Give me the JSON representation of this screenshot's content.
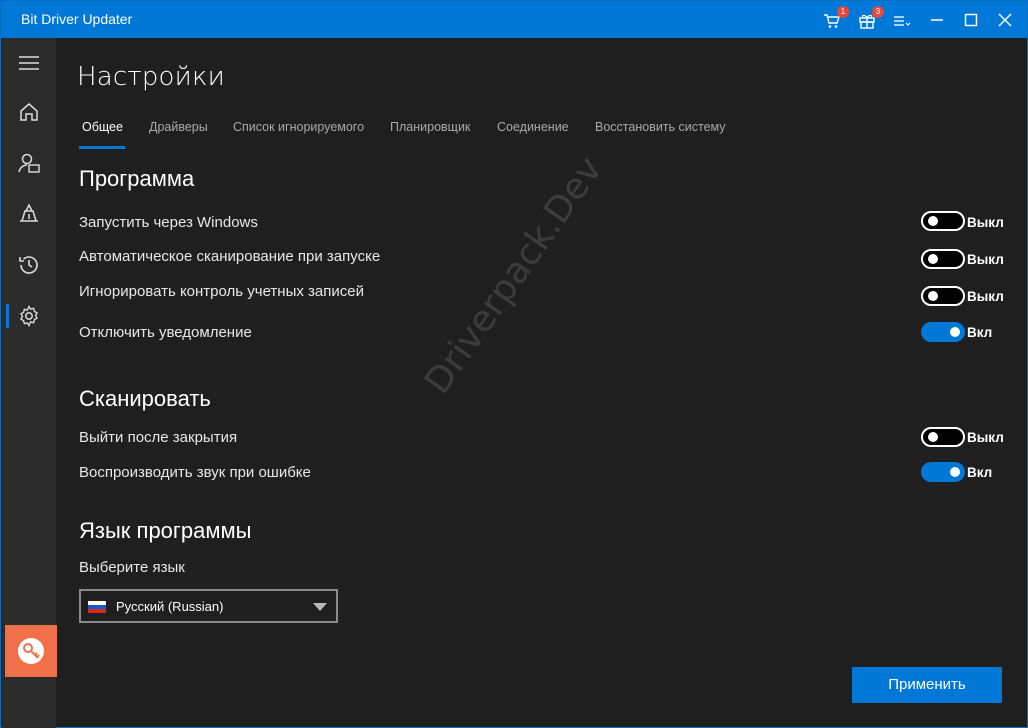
{
  "app": {
    "title": "Bit Driver Updater"
  },
  "titlebar": {
    "cart_badge": "1",
    "gift_badge": "3",
    "icons": [
      "cart-icon",
      "gift-icon",
      "menu-icon",
      "minimize-icon",
      "maximize-icon",
      "close-icon"
    ]
  },
  "sidebar": {
    "items": [
      "hamburger-icon",
      "home-icon",
      "user-scan-icon",
      "driver-icon",
      "history-icon",
      "settings-icon"
    ],
    "active": "settings-icon"
  },
  "page": {
    "title": "Настройки"
  },
  "tabs": [
    {
      "label": "Общее",
      "active": true
    },
    {
      "label": "Драйверы",
      "active": false
    },
    {
      "label": "Список игнорируемого",
      "active": false
    },
    {
      "label": "Планировщик",
      "active": false
    },
    {
      "label": "Соединение",
      "active": false
    },
    {
      "label": "Восстановить систему",
      "active": false
    }
  ],
  "sections": {
    "program": {
      "title": "Программа",
      "settings": [
        {
          "label": "Запустить через Windows",
          "state": "Выкл",
          "on": false
        },
        {
          "label": "Автоматическое сканирование при запуске",
          "state": "Выкл",
          "on": false
        },
        {
          "label": "Игнорировать контроль учетных записей",
          "state": "Выкл",
          "on": false
        },
        {
          "label": "Отключить уведомление",
          "state": "Вкл",
          "on": true
        }
      ]
    },
    "scan": {
      "title": "Сканировать",
      "settings": [
        {
          "label": "Выйти после закрытия",
          "state": "Выкл",
          "on": false
        },
        {
          "label": "Воспроизводить звук при ошибке",
          "state": "Вкл",
          "on": true
        }
      ]
    },
    "language": {
      "title": "Язык программы",
      "label": "Выберите язык",
      "selected": "Русский (Russian)"
    }
  },
  "buttons": {
    "apply": "Применить"
  },
  "watermark": "Driverpack.Dev",
  "colors": {
    "accent": "#0078d7",
    "key_tile": "#f0704a",
    "badge": "#e8473b"
  }
}
